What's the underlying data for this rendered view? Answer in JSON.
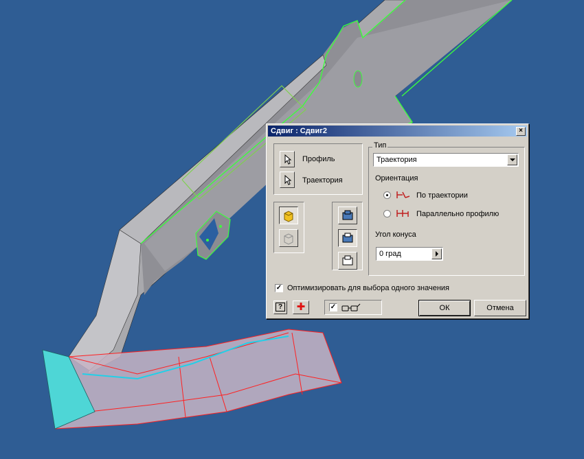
{
  "dialog": {
    "title": "Сдвиг : Сдвиг2",
    "close_glyph": "×",
    "profile_label": "Профиль",
    "path_label": "Траектория",
    "type_group_label": "Тип",
    "type_value": "Траектория",
    "orientation_label": "Ориентация",
    "orientation_options": [
      {
        "label": "По траектории",
        "selected": true
      },
      {
        "label": "Параллельно профилю",
        "selected": false
      }
    ],
    "taper_label": "Угол конуса",
    "taper_value": "0 град",
    "optimize_label": "Оптимизировать для выбора одного значения",
    "optimize_checked": "✓",
    "preview_checked": "✓",
    "ok_label": "ОК",
    "cancel_label": "Отмена",
    "help_glyph": "?",
    "plus_glyph": "✚"
  },
  "colors": {
    "background": "#2f5d94",
    "part_face": "#a9a9ad",
    "edge_highlight": "#3cff3c",
    "sweep_preview": "#c7b4c4",
    "sweep_edges": "#ff2020",
    "profile_face": "#4ed6d6",
    "path_curve": "#20d0e8",
    "title_start": "#0a246a",
    "title_end": "#a6caf0"
  },
  "icons": [
    "cursor-icon",
    "solid-output-icon",
    "surface-output-icon",
    "join-icon",
    "cut-icon",
    "intersect-icon",
    "help-icon",
    "plus-icon",
    "glasses-icon"
  ]
}
